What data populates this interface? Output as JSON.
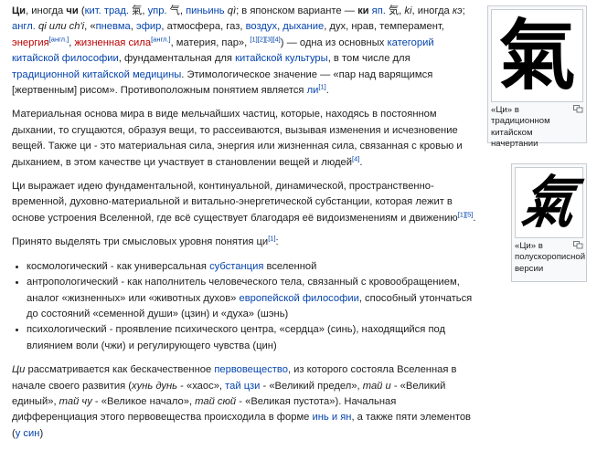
{
  "colors": {
    "link": "#0645ad",
    "redlink": "#ba0000",
    "text": "#202122"
  },
  "p1": {
    "t1": "Ци",
    "t2": ", иногда ",
    "t3": "чи",
    "t4": " (",
    "l1": "кит. трад.",
    "t5": " 氣, ",
    "l2": "упр.",
    "t6": " 气, ",
    "l3": "пиньинь",
    "t7": " ",
    "t8": "qì",
    "t9": "; в японском варианте — ",
    "t10": "ки",
    "t11": " ",
    "l4": "яп.",
    "t12": " 気, ",
    "t13": "ki",
    "t14": ", иногда ",
    "t15": "кэ",
    "t16": "; ",
    "l5": "англ.",
    "t17": " ",
    "t18": "qi или ch'i",
    "t19": ", «",
    "l6": "пневма",
    "t20": ", ",
    "l7": "эфир",
    "t21": ", атмосфера, газ, ",
    "l8": "воздух",
    "t22": ", ",
    "l9": "дыхание",
    "t23": ", дух, нрав, темперамент, ",
    "r1": "энергия",
    "s1": "[англ.]",
    "t24": ", ",
    "r2": "жизненная сила",
    "s2": "[англ.]",
    "t25": ", материя, пар», ",
    "s3": "[1][2][3][4]",
    "t26": ") — одна из основных ",
    "l10": "категорий китайской философии",
    "t27": ", фундаментальная для ",
    "l11": "китайской культуры",
    "t28": ", в том числе для ",
    "l12": "традиционной китайской медицины",
    "t29": ". Этимологическое значение — «пар над варящимся [жертвенным] рисом». Противоположным понятием является ",
    "l13": "ли",
    "s4": "[1]",
    "t30": "."
  },
  "p2": {
    "text": "Материальная основа мира в виде мельчайших частиц, которые, находясь в постоянном дыхании, то сгущаются, образуя вещи, то рассеиваются, вызывая изменения и исчезновение вещей. Также ци - это материальная сила, энергия или жизненная сила, связанная с кровью и дыханием, в этом качестве ци участвует в становлении вещей и людей",
    "s1": "[4]",
    "end": "."
  },
  "p3": {
    "text": "Ци выражает идею фундаментальной, континуальной, динамической, пространственно-временной, духовно-материальной и витально-энергетической субстанции, которая лежит в основе устроения Вселенной, где всё существует благодаря её видоизменениям и движению",
    "s1": "[1][5]",
    "end": "."
  },
  "p4": {
    "text": "Принято выделять три смысловых уровня понятия ци",
    "s1": "[1]",
    "end": ":"
  },
  "list": {
    "i1a": "космологический - как универсальная ",
    "i1l": "субстанция",
    "i1b": " вселенной",
    "i2a": "антропологический - как наполнитель человеческого тела, связанный с кровообращением, аналог «жизненных» или «животных духов» ",
    "i2l": "европейской философии",
    "i2b": ", способный утончаться до состояний «семенной души» (цзин) и «духа» (шэнь)",
    "i3": "психологический - проявление психического центра, «сердца» (синь), находящийся под влиянием воли (чжи) и регулирующего чувства (цин)"
  },
  "p5": {
    "t1": "Ци",
    "t2": " рассматривается как бескачественное ",
    "l1": "первовещество",
    "t3": ", из которого состояла Вселенная в начале своего развития (",
    "t4": "хунь дунь",
    "t5": " - «хаос», ",
    "l2": "тай цзи",
    "t6": " - «Великий предел», ",
    "t7": "тай и",
    "t8": " - «Великий единый», ",
    "t9": "тай чу",
    "t10": " - «Великое начало», ",
    "t11": "тай сюй",
    "t12": " - «Великая пустота»). Начальная дифференциация этого первовещества происходила в форме ",
    "l3": "инь и ян",
    "t13": ", а также пяти элементов (",
    "l4": "у син",
    "t14": ")"
  },
  "figures": {
    "f1": {
      "glyph": "氣",
      "caption": "«Ци» в традиционном китайском начертании"
    },
    "f2": {
      "glyph": "氣",
      "caption": "«Ци» в полускорописной версии"
    }
  }
}
